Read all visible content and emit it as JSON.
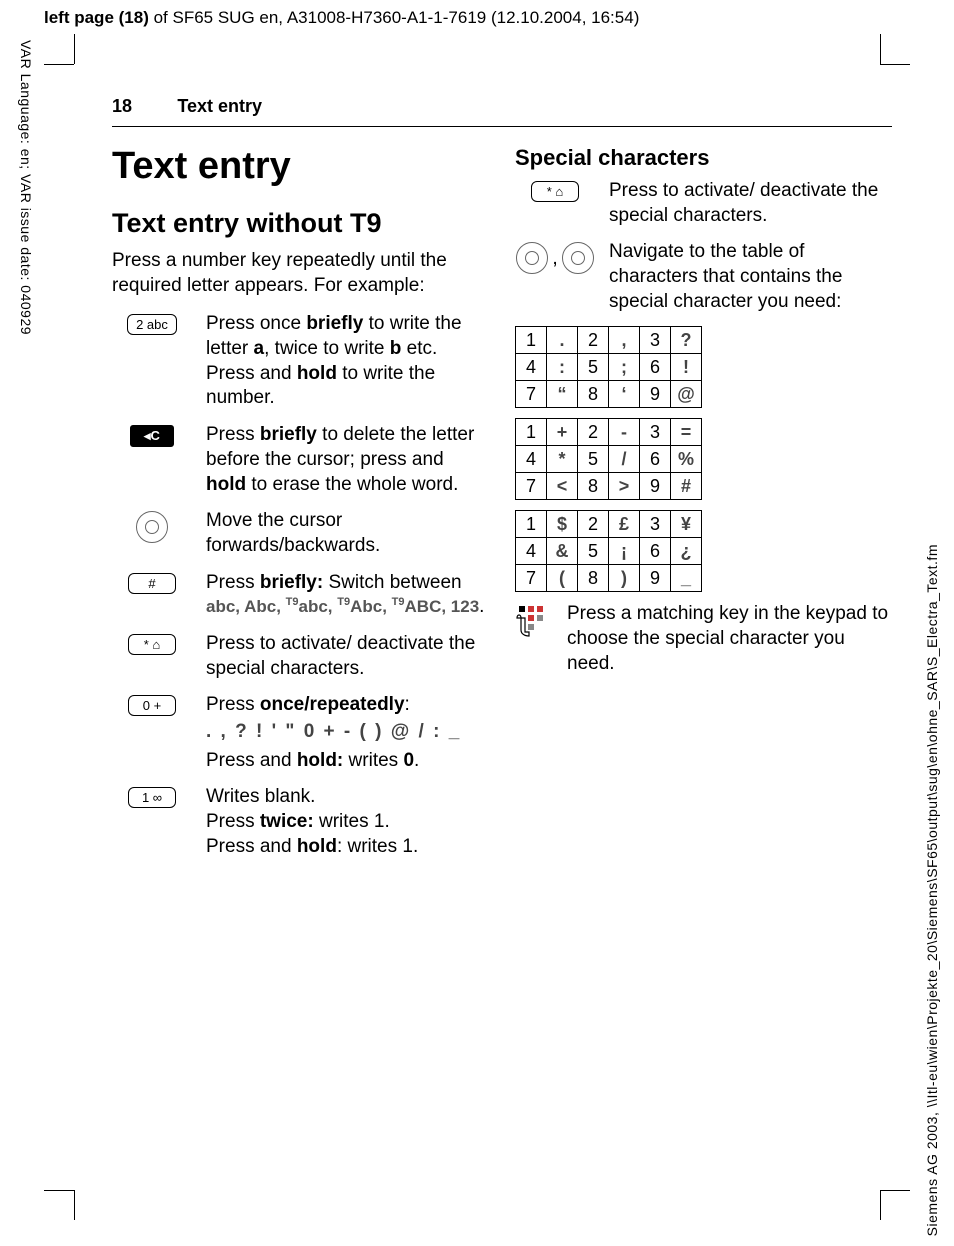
{
  "meta": {
    "top_header_prefix": "left page (18)",
    "top_header_rest": " of SF65 SUG en, A31008-H7360-A1-1-7619 (12.10.2004, 16:54)",
    "side_left": "VAR Language: en; VAR issue date: 040929",
    "side_right": "Siemens AG 2003, \\\\Itl-eu\\wien\\Projekte_20\\Siemens\\SF65\\output\\sug\\en\\ohne_SAR\\S_Electra_Text.fm"
  },
  "header": {
    "page_number": "18",
    "running_title": "Text entry"
  },
  "left": {
    "title": "Text entry",
    "subtitle": "Text entry without T9",
    "intro": "Press a number key repeatedly until the required letter appears. For example:",
    "rows": [
      {
        "key_label": "2 abc",
        "key_style": "cap",
        "parts": [
          "Press once ",
          "briefly",
          " to write the letter ",
          "a",
          ", twice to write ",
          "b",
          " etc. Press and ",
          "hold",
          " to write the number."
        ]
      },
      {
        "key_label": "◂C",
        "key_style": "dark",
        "parts": [
          "Press ",
          "briefly",
          " to delete the letter before the cursor; press and ",
          "hold",
          " to erase the whole word."
        ]
      },
      {
        "key_label": "nav-h",
        "key_style": "nav",
        "text": "Move the cursor forwards/backwards."
      },
      {
        "key_label": "#",
        "key_style": "cap",
        "parts_modes": {
          "pre": [
            "Press ",
            "briefly:",
            " Switch between "
          ],
          "modes": "abc, Abc, T9abc, T9Abc, T9ABC, 123",
          "post": "."
        }
      },
      {
        "key_label": "* ⌂",
        "key_style": "cap",
        "text": "Press to activate/ deactivate the special characters."
      },
      {
        "key_label": "0 +",
        "key_style": "cap",
        "heading": "Press once/repeatedly:",
        "charline": ". , ? ! ' \" 0 + - ( ) @ / : _",
        "tail_parts": [
          "Press and ",
          "hold:",
          " writes ",
          "0",
          "."
        ]
      },
      {
        "key_label": "1 ∞",
        "key_style": "cap",
        "lines": [
          {
            "plain": "Writes blank."
          },
          {
            "parts": [
              "Press ",
              "twice:",
              " writes 1."
            ]
          },
          {
            "parts": [
              "Press and ",
              "hold",
              ": writes 1."
            ]
          }
        ]
      }
    ]
  },
  "right": {
    "heading": "Special characters",
    "star_text": "Press to activate/ deactivate the special characters.",
    "nav_text": "Navigate to the table of characters that contains the special character you need:",
    "tables": [
      [
        [
          "1",
          ".",
          "2",
          ",",
          "3",
          "?"
        ],
        [
          "4",
          ":",
          "5",
          ";",
          "6",
          "!"
        ],
        [
          "7",
          "“",
          "8",
          "‘",
          "9",
          "@"
        ]
      ],
      [
        [
          "1",
          "+",
          "2",
          "-",
          "3",
          "="
        ],
        [
          "4",
          "*",
          "5",
          "/",
          "6",
          "%"
        ],
        [
          "7",
          "<",
          "8",
          ">",
          "9",
          "#"
        ]
      ],
      [
        [
          "1",
          "$",
          "2",
          "£",
          "3",
          "¥"
        ],
        [
          "4",
          "&",
          "5",
          "¡",
          "6",
          "¿"
        ],
        [
          "7",
          "(",
          "8",
          ")",
          "9",
          "_"
        ]
      ]
    ],
    "hand_text": "Press a matching key in the keypad to choose the special character you need."
  }
}
